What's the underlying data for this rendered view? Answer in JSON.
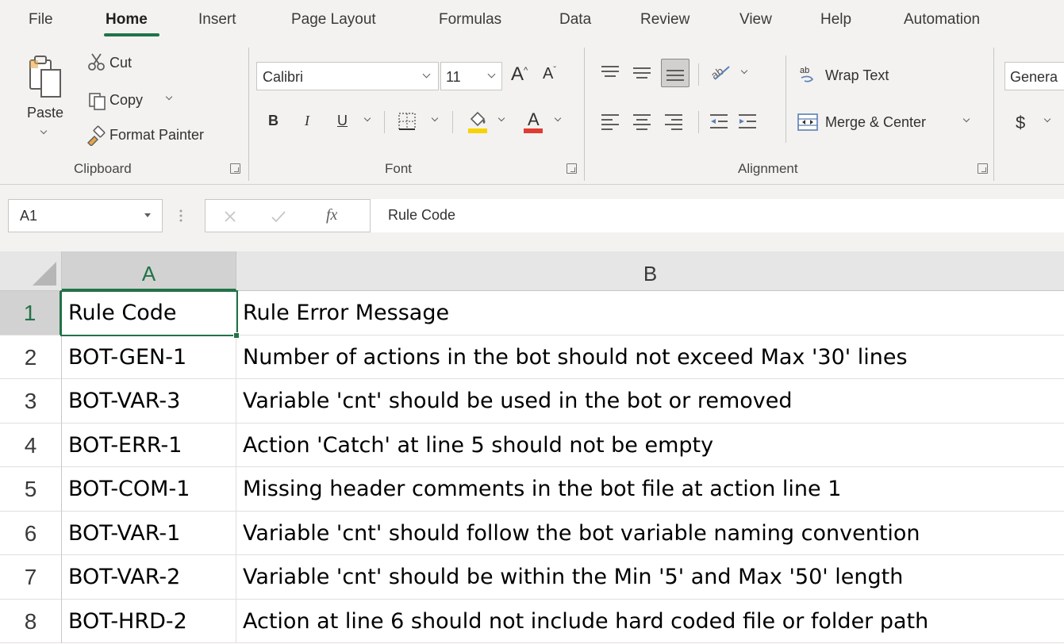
{
  "menu": {
    "tabs": [
      "File",
      "Home",
      "Insert",
      "Page Layout",
      "Formulas",
      "Data",
      "Review",
      "View",
      "Help",
      "Automation"
    ],
    "active_tab": "Home"
  },
  "ribbon": {
    "clipboard": {
      "paste": "Paste",
      "cut": "Cut",
      "copy": "Copy",
      "format_painter": "Format Painter",
      "label": "Clipboard"
    },
    "font": {
      "font_name": "Calibri",
      "font_size": "11",
      "bold": "B",
      "italic": "I",
      "underline": "U",
      "label": "Font",
      "highlight_color": "#f7d300",
      "text_color": "#e03c31"
    },
    "alignment": {
      "wrap_text": "Wrap Text",
      "merge_center": "Merge & Center",
      "label": "Alignment"
    },
    "number": {
      "format": "Genera",
      "currency": "$"
    }
  },
  "formula_bar": {
    "name_box": "A1",
    "fx": "fx",
    "formula": "Rule Code"
  },
  "sheet": {
    "columns": [
      "A",
      "B"
    ],
    "active_column": "A",
    "rows": [
      {
        "num": "1",
        "a": "Rule Code",
        "b": "Rule Error Message"
      },
      {
        "num": "2",
        "a": "BOT-GEN-1",
        "b": "Number of actions in the bot should not exceed Max '30' lines"
      },
      {
        "num": "3",
        "a": "BOT-VAR-3",
        "b": "Variable 'cnt' should be used in the bot or removed"
      },
      {
        "num": "4",
        "a": "BOT-ERR-1",
        "b": "Action 'Catch' at line 5 should not be empty"
      },
      {
        "num": "5",
        "a": "BOT-COM-1",
        "b": "Missing header comments in the bot file at action line 1"
      },
      {
        "num": "6",
        "a": "BOT-VAR-1",
        "b": "Variable 'cnt' should follow the bot variable naming convention"
      },
      {
        "num": "7",
        "a": "BOT-VAR-2",
        "b": "Variable 'cnt' should be within the Min '5' and Max '50' length"
      },
      {
        "num": "8",
        "a": "BOT-HRD-2",
        "b": "Action at line 6 should not include hard coded file or folder path"
      }
    ]
  },
  "colors": {
    "accent": "#217346"
  }
}
